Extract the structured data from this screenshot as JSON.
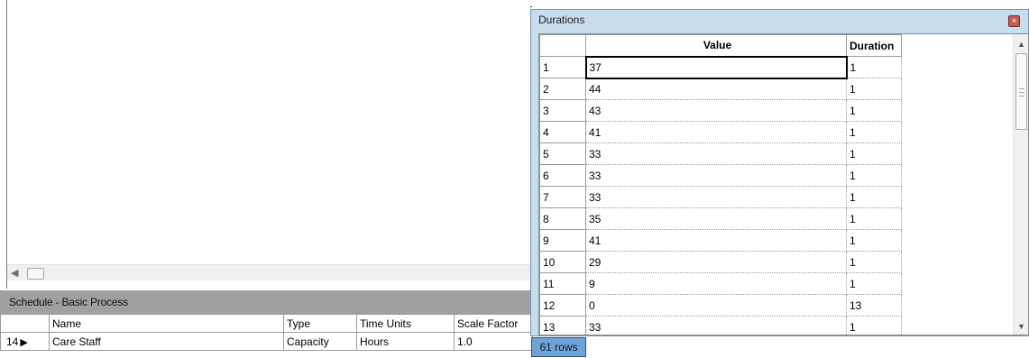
{
  "canvas": {
    "scroll_left_arrow": "◀"
  },
  "schedule": {
    "title": "Schedule - Basic Process",
    "columns": [
      "Name",
      "Type",
      "Time Units",
      "Scale Factor"
    ],
    "row": {
      "number": "14",
      "indicator": "▶",
      "name": "Care Staff",
      "type": "Capacity",
      "time_units": "Hours",
      "scale_factor": "1.0"
    }
  },
  "durations": {
    "title": "Durations",
    "close_icon": "×",
    "headers": {
      "value": "Value",
      "duration": "Duration"
    },
    "rows": [
      {
        "idx": "1",
        "value": "37",
        "duration": "1"
      },
      {
        "idx": "2",
        "value": "44",
        "duration": "1"
      },
      {
        "idx": "3",
        "value": "43",
        "duration": "1"
      },
      {
        "idx": "4",
        "value": "41",
        "duration": "1"
      },
      {
        "idx": "5",
        "value": "33",
        "duration": "1"
      },
      {
        "idx": "6",
        "value": "33",
        "duration": "1"
      },
      {
        "idx": "7",
        "value": "33",
        "duration": "1"
      },
      {
        "idx": "8",
        "value": "35",
        "duration": "1"
      },
      {
        "idx": "9",
        "value": "41",
        "duration": "1"
      },
      {
        "idx": "10",
        "value": "29",
        "duration": "1"
      },
      {
        "idx": "11",
        "value": "9",
        "duration": "1"
      },
      {
        "idx": "12",
        "value": "0",
        "duration": "13"
      },
      {
        "idx": "13",
        "value": "33",
        "duration": "1"
      }
    ],
    "scroll_up": "▲",
    "scroll_down": "▼",
    "row_count_label": "61 rows"
  }
}
